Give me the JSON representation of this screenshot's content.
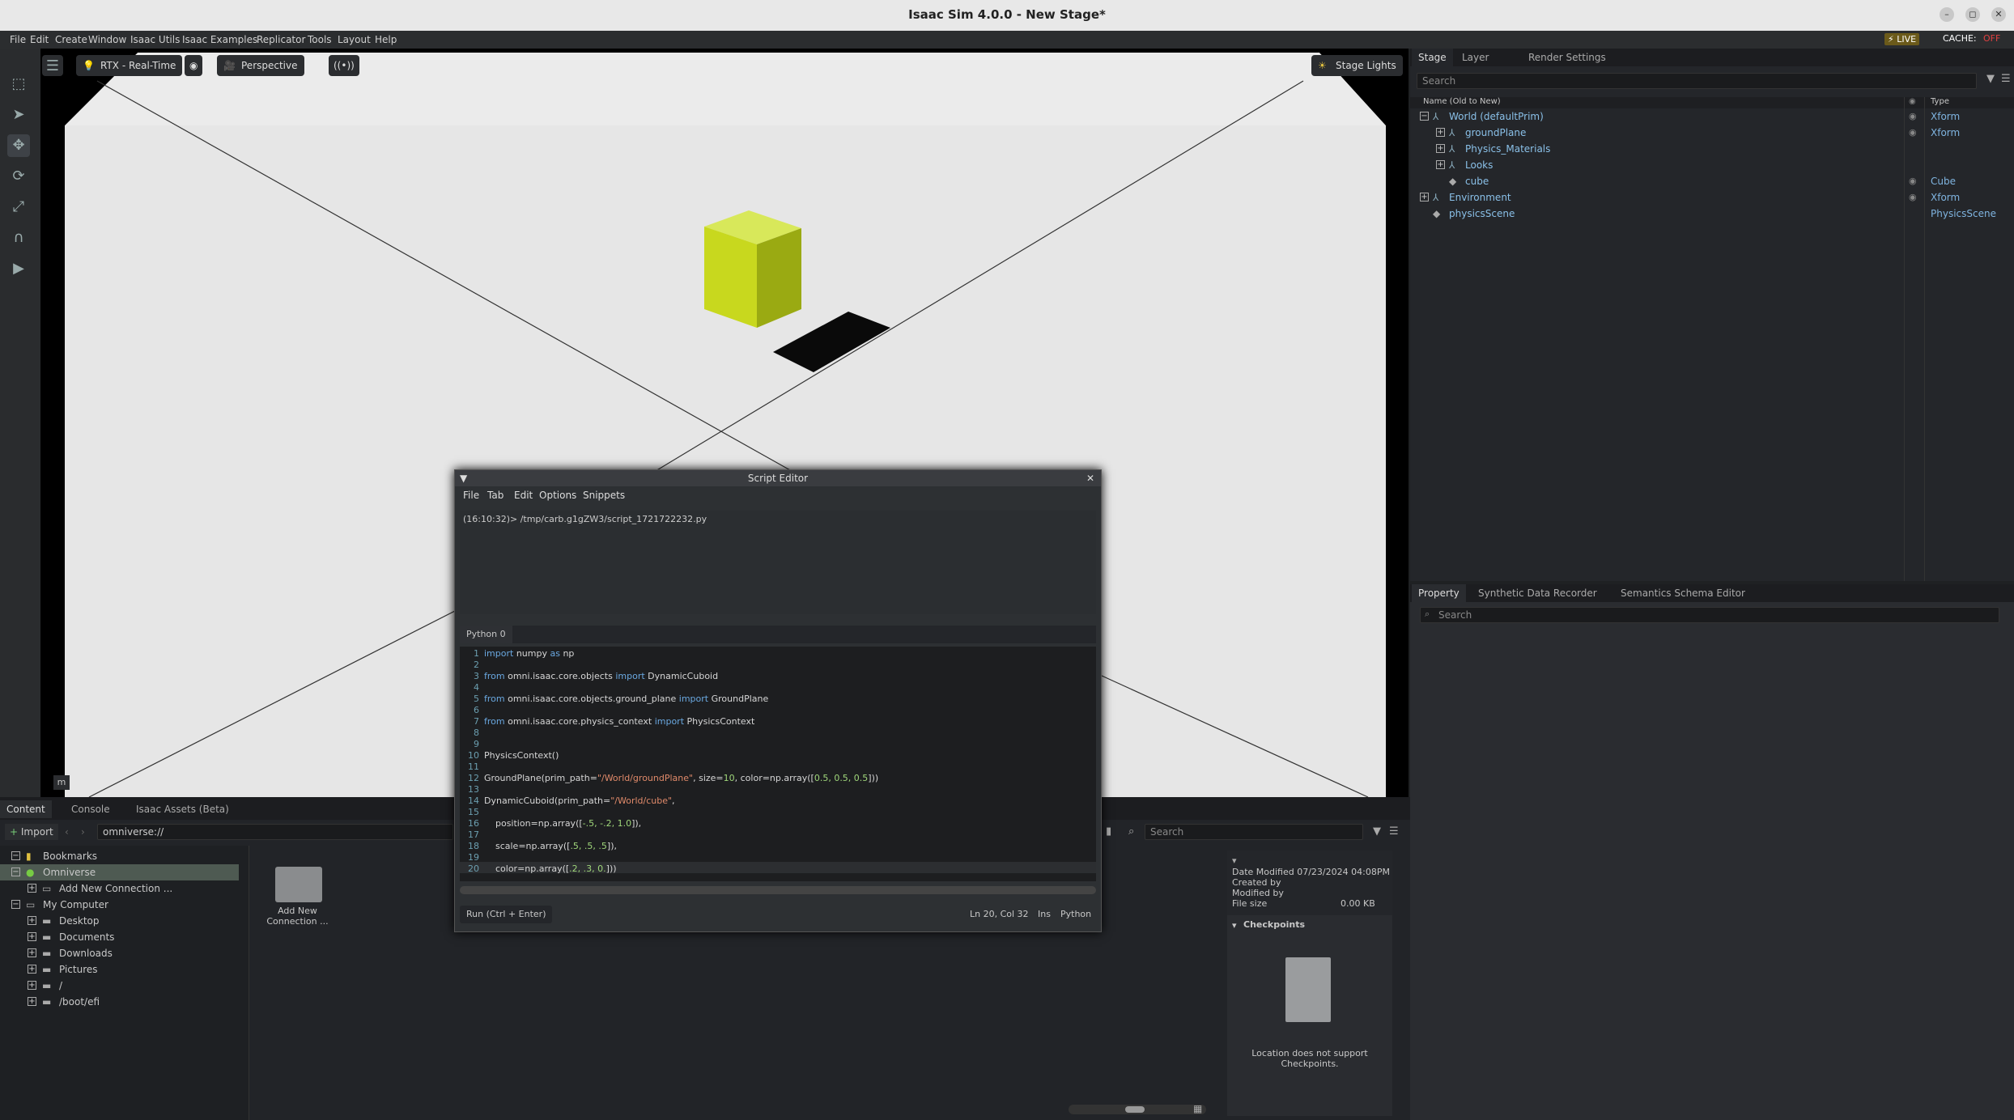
{
  "window": {
    "title": "Isaac Sim 4.0.0 - New Stage*"
  },
  "menu": [
    "File",
    "Edit",
    "Create",
    "Window",
    "Isaac Utils",
    "Isaac Examples",
    "Replicator",
    "Tools",
    "Layout",
    "Help"
  ],
  "status": {
    "live": "LIVE",
    "cache": "CACHE:",
    "cache_state": "OFF"
  },
  "viewport": {
    "render_mode": "RTX - Real-Time",
    "camera": "Perspective",
    "lights": "Stage Lights",
    "corner_label": "m"
  },
  "stage": {
    "tabs": [
      "Stage",
      "Layer",
      "Render Settings"
    ],
    "search_placeholder": "Search",
    "col_name": "Name (Old to New)",
    "col_type": "Type",
    "rows": [
      {
        "name": "World (defaultPrim)",
        "type": "Xform"
      },
      {
        "name": "groundPlane",
        "type": "Xform"
      },
      {
        "name": "Physics_Materials",
        "type": ""
      },
      {
        "name": "Looks",
        "type": ""
      },
      {
        "name": "cube",
        "type": "Cube"
      },
      {
        "name": "Environment",
        "type": "Xform"
      },
      {
        "name": "physicsScene",
        "type": "PhysicsScene"
      }
    ]
  },
  "property": {
    "tabs": [
      "Property",
      "Synthetic Data Recorder",
      "Semantics Schema Editor"
    ],
    "search_placeholder": "Search"
  },
  "content": {
    "tabs": [
      "Content",
      "Console",
      "Isaac Assets (Beta)"
    ],
    "import_label": "Import",
    "path": "omniverse://",
    "search_placeholder": "Search",
    "tree": [
      "Bookmarks",
      "Omniverse",
      "Add New Connection ...",
      "My Computer",
      "Desktop",
      "Documents",
      "Downloads",
      "Pictures",
      "/",
      "/boot/efi"
    ],
    "tile_label": "Add New\nConnection ...",
    "info": {
      "date_modified": "Date Modified 07/23/2024 04:08PM",
      "created_by": "Created by",
      "modified_by": "Modified by",
      "file_size_label": "File size",
      "file_size": "0.00 KB",
      "checkpoints": "Checkpoints",
      "checkpoint_msg": "Location does not support Checkpoints."
    }
  },
  "script_editor": {
    "title": "Script Editor",
    "menu": [
      "File",
      "Tab",
      "Edit",
      "Options",
      "Snippets"
    ],
    "output": "(16:10:32)> /tmp/carb.g1gZW3/script_1721722232.py",
    "tab": "Python 0",
    "run_label": "Run (Ctrl + Enter)",
    "cursor": "Ln 20, Col 32",
    "mode": "Ins",
    "lang": "Python"
  }
}
